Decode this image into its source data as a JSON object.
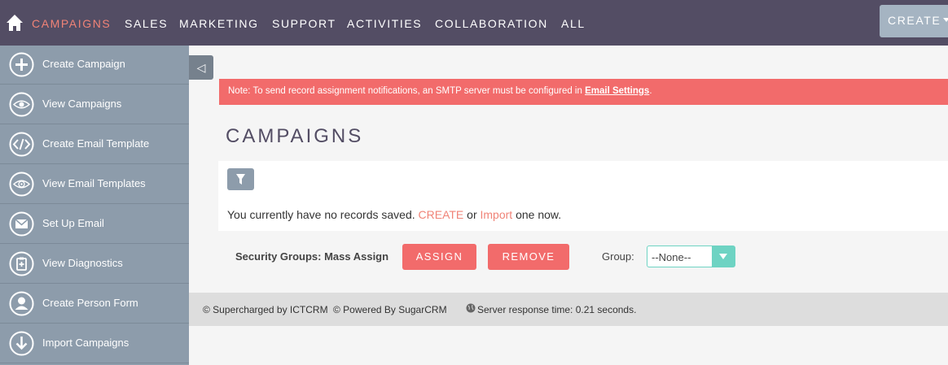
{
  "topnav": {
    "home_icon": "home-icon",
    "items": [
      {
        "label": "CAMPAIGNS",
        "active": true
      },
      {
        "label": "SALES"
      },
      {
        "label": "MARKETING"
      },
      {
        "label": "SUPPORT"
      },
      {
        "label": "ACTIVITIES"
      },
      {
        "label": "COLLABORATION"
      },
      {
        "label": "ALL"
      }
    ],
    "create_label": "CREATE",
    "colors": {
      "bar": "#534d64",
      "active": "#f08377"
    }
  },
  "sidebar": {
    "items": [
      {
        "label": "Create Campaign",
        "icon": "plus-circle-icon"
      },
      {
        "label": "View Campaigns",
        "icon": "eye-icon"
      },
      {
        "label": "Create Email Template",
        "icon": "code-icon"
      },
      {
        "label": "View Email Templates",
        "icon": "eye-at-icon"
      },
      {
        "label": "Set Up Email",
        "icon": "envelope-icon"
      },
      {
        "label": "View Diagnostics",
        "icon": "clipboard-icon"
      },
      {
        "label": "Create Person Form",
        "icon": "person-icon"
      },
      {
        "label": "Import Campaigns",
        "icon": "download-icon"
      }
    ]
  },
  "collapse_glyph": "◁",
  "alert": {
    "text": "Note: To send record assignment notifications, an SMTP server must be configured in ",
    "link": "Email Settings",
    "suffix": ".",
    "color": "#f26b6b"
  },
  "main": {
    "title": "CAMPAIGNS",
    "no_records_prefix": "You currently have no records saved. ",
    "create_link": "CREATE",
    "or_text": " or ",
    "import_link": "Import",
    "suffix": " one now."
  },
  "mass_assign": {
    "label": "Security Groups: Mass Assign",
    "assign_label": "ASSIGN",
    "remove_label": "REMOVE",
    "group_label": "Group:",
    "group_value": "--None--"
  },
  "footer": {
    "supercharged": "© Supercharged by ICTCRM",
    "powered": "© Powered By SugarCRM",
    "response": "Server response time: 0.21 seconds."
  }
}
